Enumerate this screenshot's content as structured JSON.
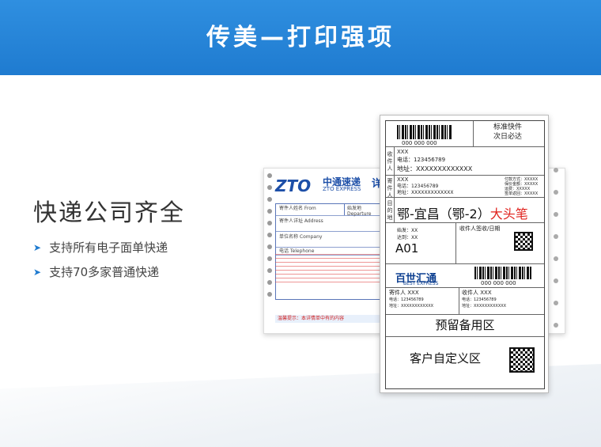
{
  "banner": {
    "title": "传美—打印强项"
  },
  "section": {
    "heading": "快递公司齐全",
    "features": [
      "支持所有电子面单快递",
      "支持70多家普通快递"
    ]
  },
  "zto_form": {
    "logo": "ZTO",
    "brand_cn": "中通速递",
    "brand_en": "ZTO EXPRESS",
    "title_partial": "详情",
    "fields": [
      "寄件人姓名 From",
      "寄件人详址 Address",
      "单位名称 Company",
      "电话 Telephone"
    ],
    "dest_header": "始发地 Departure",
    "footer_notice": "温馨提示：本详情单中有的内容"
  },
  "label": {
    "service_type": "标准快件",
    "service_sub": "次日必达",
    "barcode_number": "000 000 000",
    "recipient": {
      "side": "收件人",
      "name": "XXX",
      "phone": "电话：123456789",
      "address": "地址：XXXXXXXXXXXXX"
    },
    "sender": {
      "side": "寄件人",
      "name": "XXX",
      "phone": "电话：123456789",
      "address": "地址：XXXXXXXXXXXXX"
    },
    "payment": [
      "付款方式：XXXXX",
      "保价金额：XXXXX",
      "运费：XXXXX",
      "签单返回：XXXXX"
    ],
    "dest_side": "目的地",
    "destination": "鄂-宜昌（鄂-2）",
    "destination_red": "大头笔",
    "start_place": "始发：XX",
    "arrival": "达到：XX",
    "sign_label": "收件人签收/日期",
    "code": "A01",
    "best_cn": "百世汇通",
    "best_en": "BEST EXPRESS",
    "barcode_number_2": "000 000 000",
    "sender2": "寄件人  XXX",
    "recipient2": "收件人  XXX",
    "phone2": "电话：123456789",
    "addr2": "地址：XXXXXXXXXXXX",
    "reserve": "预留备用区",
    "custom": "客户自定义区"
  }
}
